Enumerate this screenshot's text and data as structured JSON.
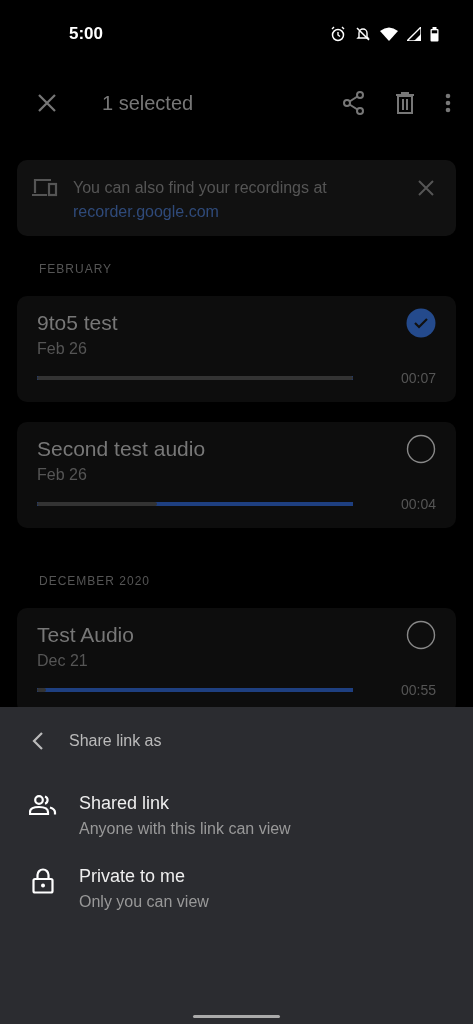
{
  "status_bar": {
    "time": "5:00"
  },
  "toolbar": {
    "title": "1 selected"
  },
  "banner": {
    "text": "You can also find your recordings at",
    "link": "recorder.google.com"
  },
  "sections": [
    {
      "heading": "FEBRUARY",
      "recordings": [
        {
          "title": "9to5 test",
          "date": "Feb 26",
          "duration": "00:07",
          "selected": true,
          "level": 1
        },
        {
          "title": "Second test audio",
          "date": "Feb 26",
          "duration": "00:04",
          "selected": false,
          "level": 0.38
        }
      ]
    },
    {
      "heading": "DECEMBER 2020",
      "recordings": [
        {
          "title": "Test Audio",
          "date": "Dec 21",
          "duration": "00:55",
          "selected": false,
          "level": 0.03
        }
      ]
    }
  ],
  "sheet": {
    "title": "Share link as",
    "options": [
      {
        "kind": "shared",
        "label": "Shared link",
        "description": "Anyone with this link can view"
      },
      {
        "kind": "private",
        "label": "Private to me",
        "description": "Only you can view"
      }
    ]
  }
}
